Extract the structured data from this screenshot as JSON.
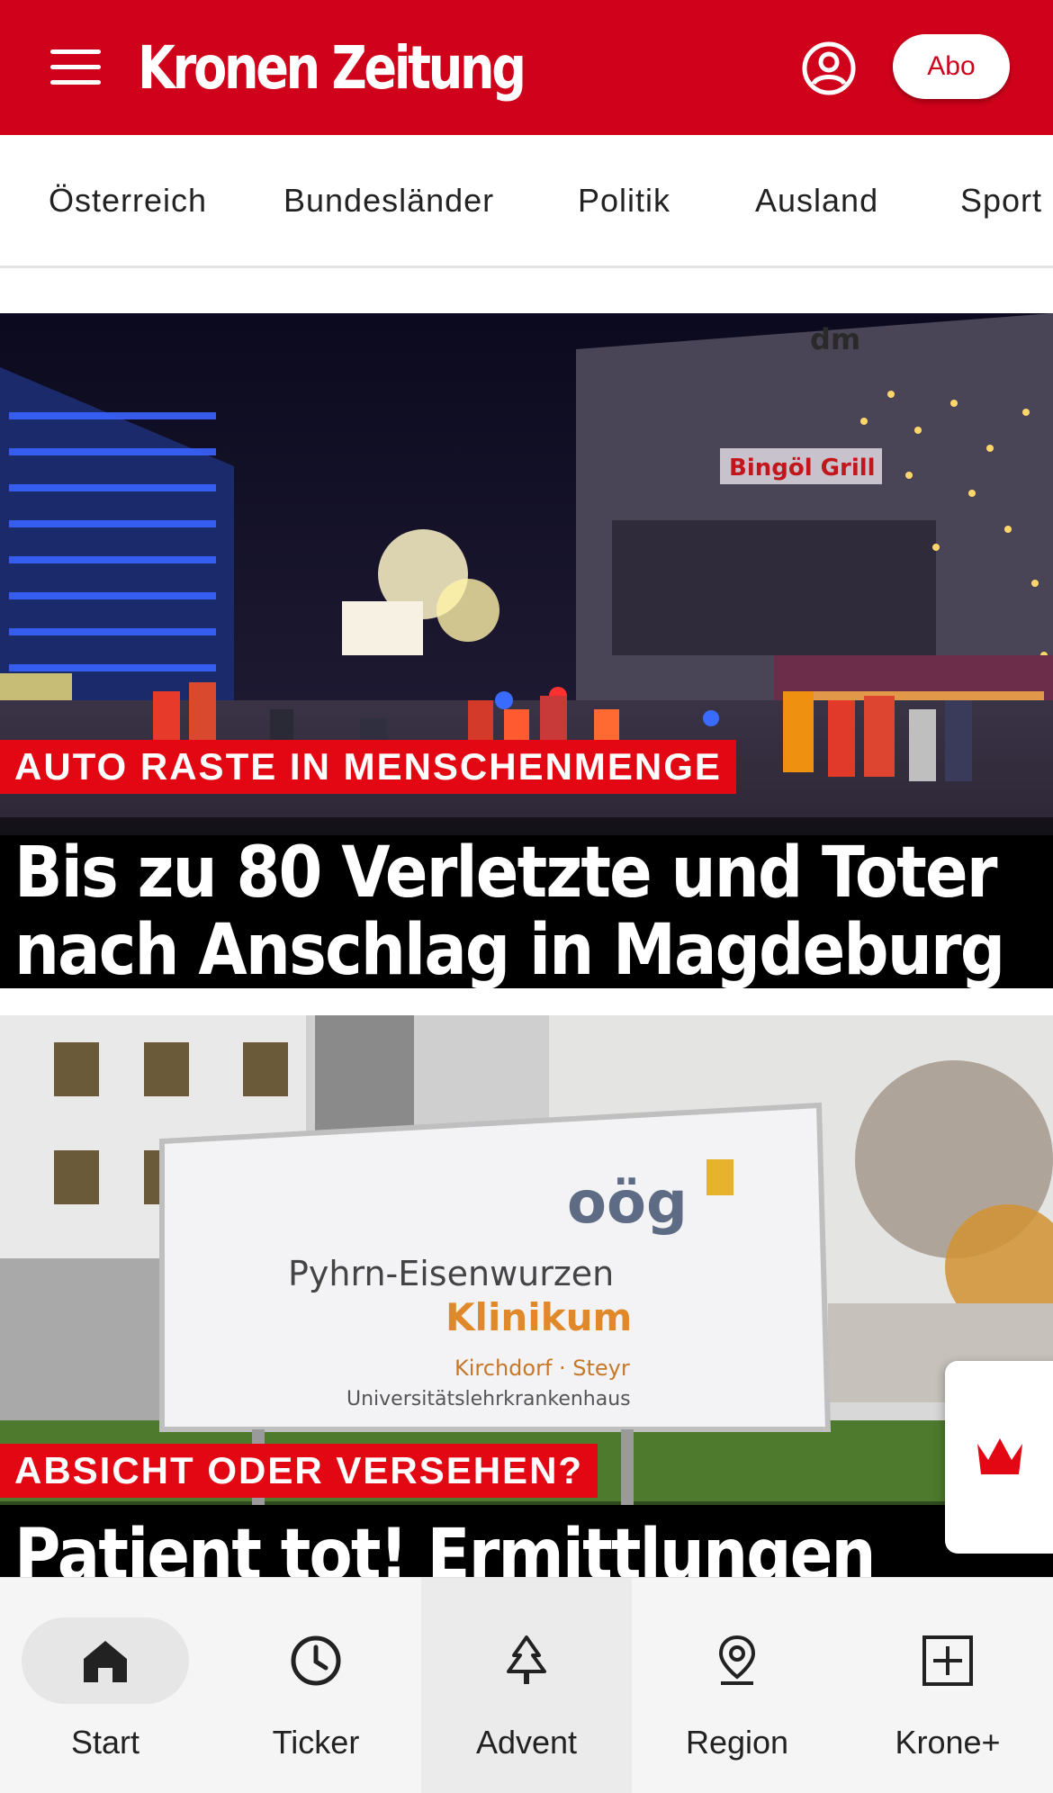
{
  "header": {
    "logo_text": "Kronen Zeitung",
    "abo_label": "Abo",
    "brand_color": "#d0021b"
  },
  "nav": {
    "items": [
      "Österreich",
      "Bundesländer",
      "Politik",
      "Ausland",
      "Sport"
    ]
  },
  "articles": [
    {
      "kicker": "AUTO RASTE IN MENSCHENMENGE",
      "headline_line1": "Bis zu 80 Verletzte und Toter",
      "headline_line2": "nach Anschlag in Magdeburg",
      "image_sign_1": "dm",
      "image_sign_2": "Bingöl Grill"
    },
    {
      "kicker": "ABSICHT ODER VERSEHEN?",
      "headline_line1": "Patient tot! Ermittlungen",
      "image_sign_logo": "oög",
      "image_sign_line1": "Pyhrn-Eisenwurzen",
      "image_sign_line2": "Klinikum",
      "image_sign_line3": "Kirchdorf · Steyr",
      "image_sign_line4": "Universitätslehrkrankenhaus"
    }
  ],
  "bottom_nav": {
    "items": [
      {
        "label": "Start",
        "icon": "home-icon"
      },
      {
        "label": "Ticker",
        "icon": "clock-icon"
      },
      {
        "label": "Advent",
        "icon": "tree-icon"
      },
      {
        "label": "Region",
        "icon": "location-pin-icon"
      },
      {
        "label": "Krone+",
        "icon": "plus-box-icon"
      }
    ]
  },
  "floating": {
    "icon": "crown-icon",
    "color": "#e30613"
  }
}
